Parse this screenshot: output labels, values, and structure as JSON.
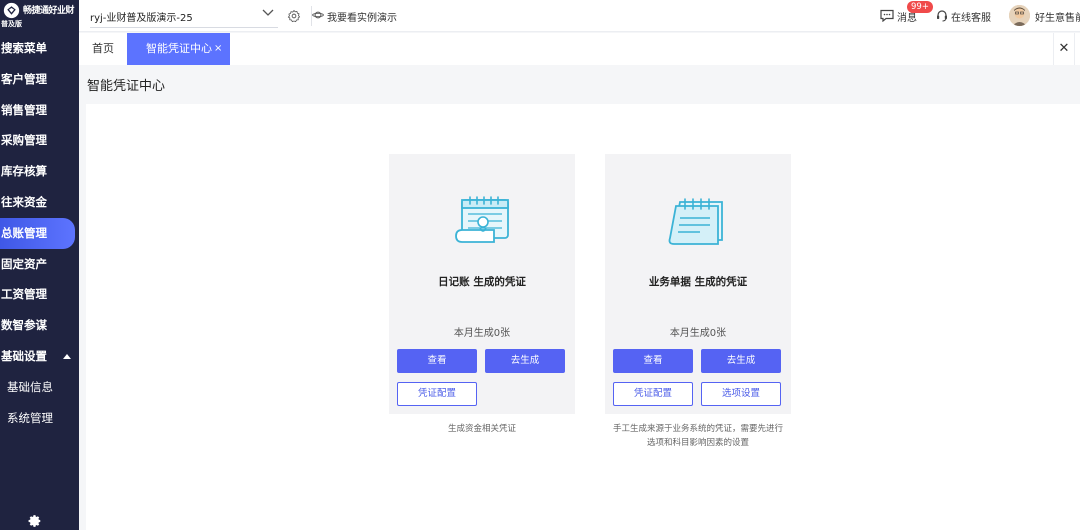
{
  "app": {
    "logo_name": "畅捷通好业财",
    "logo_sub": "普及版"
  },
  "sidebar": {
    "items": [
      {
        "label": "搜索菜单"
      },
      {
        "label": "客户管理"
      },
      {
        "label": "销售管理"
      },
      {
        "label": "采购管理"
      },
      {
        "label": "库存核算"
      },
      {
        "label": "往来资金"
      },
      {
        "label": "总账管理"
      },
      {
        "label": "固定资产"
      },
      {
        "label": "工资管理"
      },
      {
        "label": "数智参谋"
      },
      {
        "label": "基础设置"
      },
      {
        "label": "基础信息"
      },
      {
        "label": "系统管理"
      }
    ],
    "active_index": 6
  },
  "topbar": {
    "account": "ryj-业财普及版演示-25",
    "demo_link": "我要看实例演示",
    "messages_label": "消息",
    "messages_badge": "99+",
    "support_label": "在线客服",
    "user_label": "好生意售前"
  },
  "tabs": {
    "home": "首页",
    "active": "智能凭证中心",
    "close_glyph": "×",
    "bar_close_glyph": "✕"
  },
  "page": {
    "title": "智能凭证中心"
  },
  "cards": [
    {
      "title": "日记账 生成的凭证",
      "count": "本月生成0张",
      "view_label": "查看",
      "generate_label": "去生成",
      "config_label": "凭证配置",
      "desc": "生成资金相关凭证"
    },
    {
      "title": "业务单据 生成的凭证",
      "count": "本月生成0张",
      "view_label": "查看",
      "generate_label": "去生成",
      "config_label": "凭证配置",
      "options_label": "选项设置",
      "desc_line1": "手工生成来源于业务系统的凭证，需要先进行",
      "desc_line2": "选项和科目影响因素的设置"
    }
  ],
  "colors": {
    "sidebar_bg": "#1f2340",
    "accent": "#5c73ff",
    "button_primary": "#5563f3",
    "badge": "#f04a4a"
  }
}
